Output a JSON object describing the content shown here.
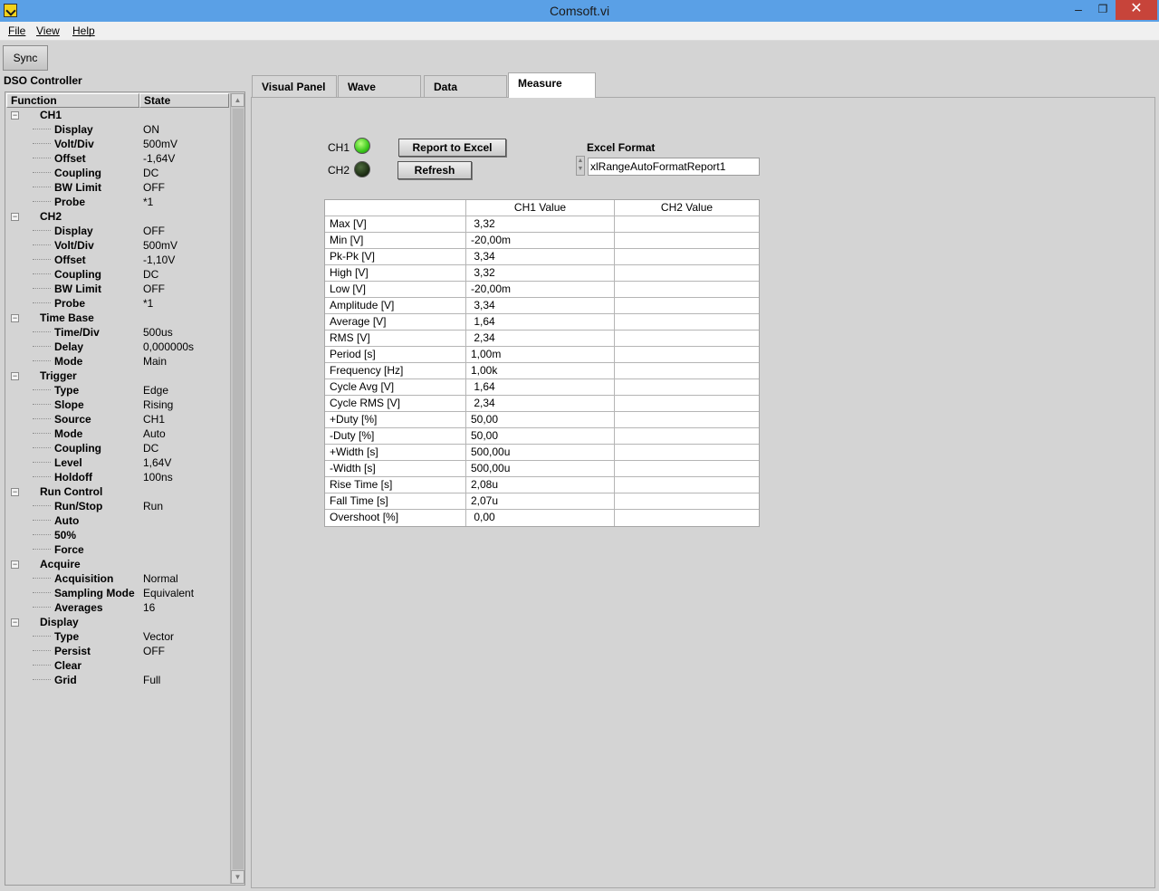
{
  "window": {
    "title": "Comsoft.vi",
    "minimize": "–",
    "maximize": "❐",
    "close": "✕"
  },
  "menu": [
    "File",
    "View",
    "Help"
  ],
  "toolbar": {
    "sync_label": "Sync"
  },
  "left_panel": {
    "title": "DSO Controller",
    "headers": {
      "function": "Function",
      "state": "State"
    },
    "groups": [
      {
        "name": "CH1",
        "items": [
          {
            "label": "Display",
            "value": "ON"
          },
          {
            "label": "Volt/Div",
            "value": "500mV"
          },
          {
            "label": "Offset",
            "value": "-1,64V"
          },
          {
            "label": "Coupling",
            "value": "DC"
          },
          {
            "label": "BW Limit",
            "value": "OFF"
          },
          {
            "label": "Probe",
            "value": "*1"
          }
        ]
      },
      {
        "name": "CH2",
        "items": [
          {
            "label": "Display",
            "value": "OFF"
          },
          {
            "label": "Volt/Div",
            "value": "500mV"
          },
          {
            "label": "Offset",
            "value": "-1,10V"
          },
          {
            "label": "Coupling",
            "value": "DC"
          },
          {
            "label": "BW Limit",
            "value": "OFF"
          },
          {
            "label": "Probe",
            "value": "*1"
          }
        ]
      },
      {
        "name": "Time Base",
        "items": [
          {
            "label": "Time/Div",
            "value": "500us"
          },
          {
            "label": "Delay",
            "value": "0,000000s"
          },
          {
            "label": "Mode",
            "value": "Main"
          }
        ]
      },
      {
        "name": "Trigger",
        "items": [
          {
            "label": "Type",
            "value": "Edge"
          },
          {
            "label": "Slope",
            "value": "Rising"
          },
          {
            "label": "Source",
            "value": "CH1"
          },
          {
            "label": "Mode",
            "value": "Auto"
          },
          {
            "label": "Coupling",
            "value": "DC"
          },
          {
            "label": "Level",
            "value": "1,64V"
          },
          {
            "label": "Holdoff",
            "value": "100ns"
          }
        ]
      },
      {
        "name": "Run Control",
        "items": [
          {
            "label": "Run/Stop",
            "value": "Run"
          },
          {
            "label": "Auto",
            "value": ""
          },
          {
            "label": "50%",
            "value": ""
          },
          {
            "label": "Force",
            "value": ""
          }
        ]
      },
      {
        "name": "Acquire",
        "items": [
          {
            "label": "Acquisition",
            "value": "Normal"
          },
          {
            "label": "Sampling Mode",
            "value": "Equivalent"
          },
          {
            "label": "Averages",
            "value": "16"
          }
        ]
      },
      {
        "name": "Display",
        "items": [
          {
            "label": "Type",
            "value": "Vector"
          },
          {
            "label": "Persist",
            "value": "OFF"
          },
          {
            "label": "Clear",
            "value": ""
          },
          {
            "label": "Grid",
            "value": "Full"
          }
        ]
      }
    ]
  },
  "tabs": [
    "Visual Panel",
    "Wave",
    "Data",
    "Measure"
  ],
  "active_tab": "Measure",
  "measure": {
    "ch1_label": "CH1",
    "ch2_label": "CH2",
    "ch1_led": "on",
    "ch2_led": "off",
    "report_button": "Report to Excel",
    "refresh_button": "Refresh",
    "excel_format_label": "Excel Format",
    "excel_format_value": "xlRangeAutoFormatReport1",
    "table": {
      "headers": [
        "",
        "CH1 Value",
        "CH2 Value"
      ],
      "rows": [
        [
          "Max [V]",
          " 3,32",
          ""
        ],
        [
          "Min [V]",
          "-20,00m",
          ""
        ],
        [
          "Pk-Pk [V]",
          " 3,34",
          ""
        ],
        [
          "High [V]",
          " 3,32",
          ""
        ],
        [
          "Low [V]",
          "-20,00m",
          ""
        ],
        [
          "Amplitude [V]",
          " 3,34",
          ""
        ],
        [
          "Average [V]",
          " 1,64",
          ""
        ],
        [
          "RMS [V]",
          " 2,34",
          ""
        ],
        [
          "Period [s]",
          "1,00m",
          ""
        ],
        [
          "Frequency [Hz]",
          "1,00k",
          ""
        ],
        [
          "Cycle Avg [V]",
          " 1,64",
          ""
        ],
        [
          "Cycle RMS [V]",
          " 2,34",
          ""
        ],
        [
          "+Duty [%]",
          "50,00",
          ""
        ],
        [
          "-Duty [%]",
          "50,00",
          ""
        ],
        [
          "+Width [s]",
          "500,00u",
          ""
        ],
        [
          "-Width [s]",
          "500,00u",
          ""
        ],
        [
          "Rise Time [s]",
          "2,08u",
          ""
        ],
        [
          "Fall Time [s]",
          "2,07u",
          ""
        ],
        [
          "Overshoot [%]",
          " 0,00",
          ""
        ]
      ]
    }
  }
}
